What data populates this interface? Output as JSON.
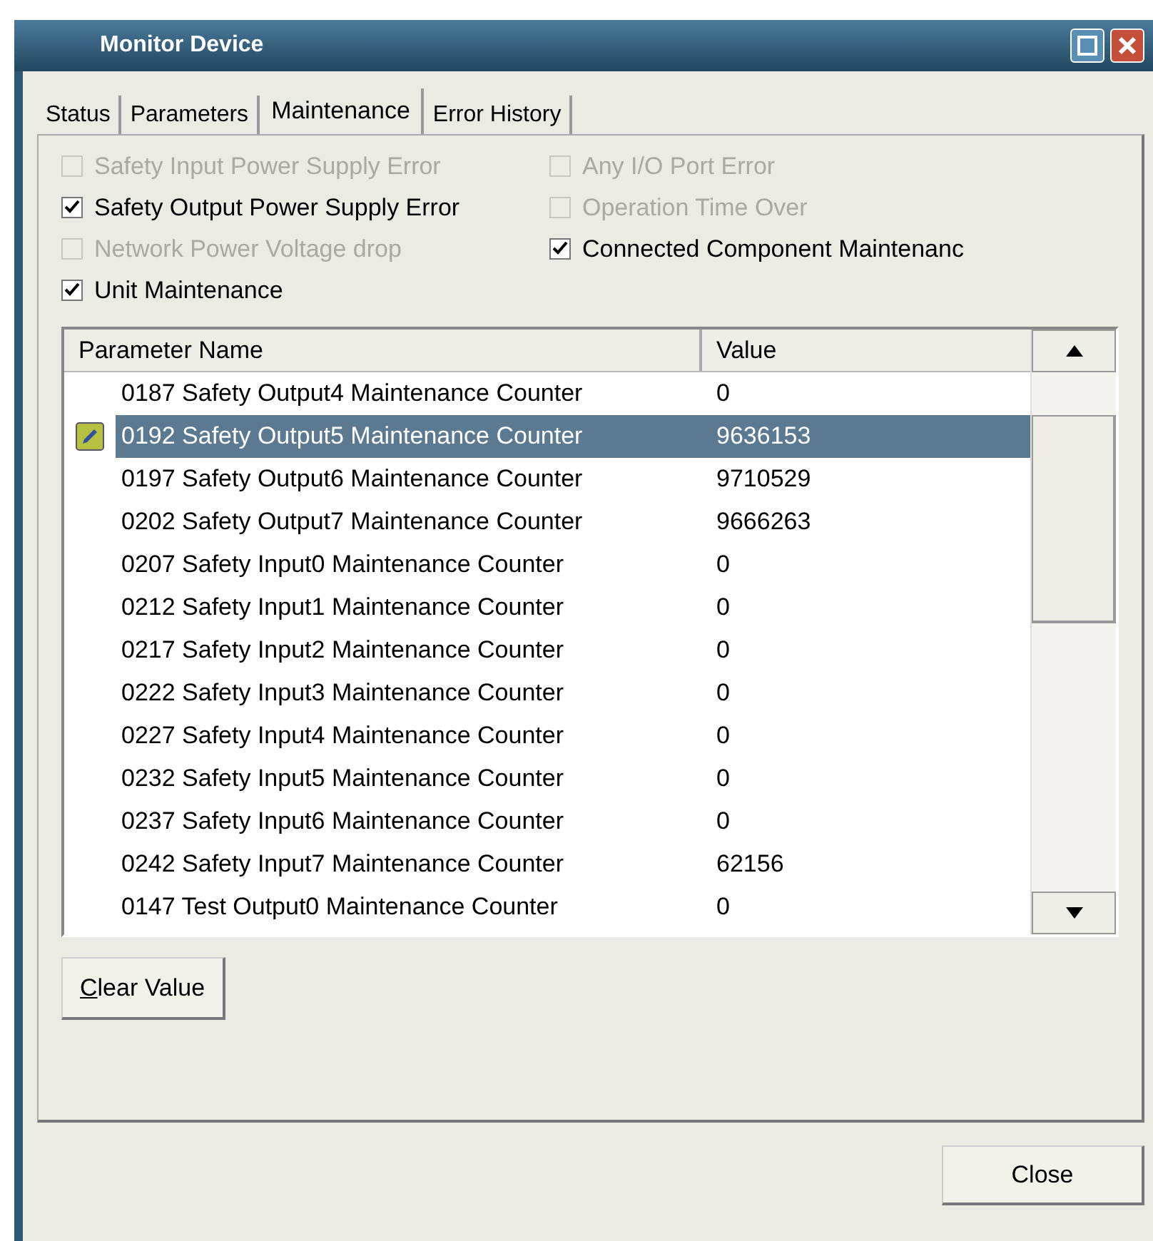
{
  "window": {
    "title": "Monitor Device"
  },
  "tabs": [
    {
      "label": "Status",
      "selected": false
    },
    {
      "label": "Parameters",
      "selected": false
    },
    {
      "label": "Maintenance",
      "selected": true
    },
    {
      "label": "Error History",
      "selected": false
    }
  ],
  "checkboxes": [
    {
      "label": "Safety Input Power Supply Error",
      "checked": false,
      "disabled": true
    },
    {
      "label": "Any I/O Port Error",
      "checked": false,
      "disabled": true
    },
    {
      "label": "Safety Output Power Supply Error",
      "checked": true,
      "disabled": false
    },
    {
      "label": "Operation Time Over",
      "checked": false,
      "disabled": true
    },
    {
      "label": "Network Power Voltage drop",
      "checked": false,
      "disabled": true
    },
    {
      "label": "Connected Component Maintenanc",
      "checked": true,
      "disabled": false
    },
    {
      "label": "Unit Maintenance",
      "checked": true,
      "disabled": false
    }
  ],
  "table": {
    "columns": [
      "Parameter Name",
      "Value"
    ],
    "rows": [
      {
        "name": "0187 Safety Output4 Maintenance Counter",
        "value": "0",
        "selected": false
      },
      {
        "name": "0192 Safety Output5 Maintenance Counter",
        "value": "9636153",
        "selected": true
      },
      {
        "name": "0197 Safety Output6 Maintenance Counter",
        "value": "9710529",
        "selected": false
      },
      {
        "name": "0202 Safety Output7 Maintenance Counter",
        "value": "9666263",
        "selected": false
      },
      {
        "name": "0207 Safety Input0 Maintenance Counter",
        "value": "0",
        "selected": false
      },
      {
        "name": "0212 Safety Input1 Maintenance Counter",
        "value": "0",
        "selected": false
      },
      {
        "name": "0217 Safety Input2 Maintenance Counter",
        "value": "0",
        "selected": false
      },
      {
        "name": "0222 Safety Input3 Maintenance Counter",
        "value": "0",
        "selected": false
      },
      {
        "name": "0227 Safety Input4 Maintenance Counter",
        "value": "0",
        "selected": false
      },
      {
        "name": "0232 Safety Input5 Maintenance Counter",
        "value": "0",
        "selected": false
      },
      {
        "name": "0237 Safety Input6 Maintenance Counter",
        "value": "0",
        "selected": false
      },
      {
        "name": "0242 Safety Input7 Maintenance Counter",
        "value": "62156",
        "selected": false
      },
      {
        "name": "0147 Test Output0 Maintenance Counter",
        "value": "0",
        "selected": false
      }
    ]
  },
  "buttons": {
    "clear": "Clear Value",
    "close": "Close"
  }
}
